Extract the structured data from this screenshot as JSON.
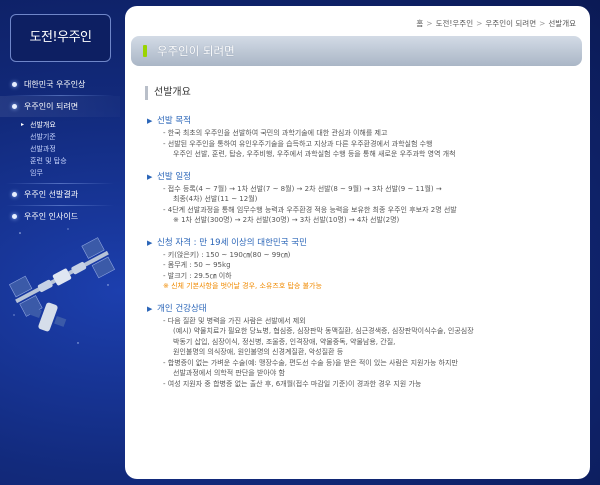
{
  "brand": {
    "logo_text": "도전!우주인"
  },
  "nav": {
    "items": [
      {
        "label": "대한민국 우주인상",
        "active": false
      },
      {
        "label": "우주인이 되려면",
        "active": true,
        "children": [
          {
            "label": "선발개요",
            "current": true
          },
          {
            "label": "선발기준",
            "current": false
          },
          {
            "label": "선발과정",
            "current": false
          },
          {
            "label": "훈련 및 탑승",
            "current": false
          },
          {
            "label": "임무",
            "current": false
          }
        ]
      },
      {
        "label": "우주인 선발결과",
        "active": false
      },
      {
        "label": "우주인 인사이드",
        "active": false
      }
    ]
  },
  "breadcrumb": [
    "홈",
    "도전!우주인",
    "우주인이 되려면",
    "선발개요"
  ],
  "breadcrumb_separator": ">",
  "page_title": "우주인이 되려면",
  "section_title": "선발개요",
  "blocks": [
    {
      "title": "선발 목적",
      "lines": [
        {
          "text": "- 한국 최초의 우주인을 선발하여 국민의 과학기술에 대한 관심과 이해를 제고",
          "indent": false,
          "warn": false
        },
        {
          "text": "- 선발된 우주인을 통하여 유인우주기술을 습득하고 지상과 다른 우주환경에서 과학실험 수행",
          "indent": false,
          "warn": false
        },
        {
          "text": "우주인 선발, 훈련, 탑승, 우주비행, 우주에서 과학실험 수행 등을 통해 새로운 우주과학 영역 개척",
          "indent": false,
          "warn": false
        }
      ]
    },
    {
      "title": "선발 일정",
      "lines": [
        {
          "text": "- 접수 등록(4 ~ 7월) → 1차 선발(7 ~ 8월) → 2차 선발(8 ~ 9월) → 3차 선발(9 ~ 11월) →",
          "indent": false,
          "warn": false
        },
        {
          "text": "최종(4차) 선발(11 ~ 12월)",
          "indent": true,
          "warn": false
        },
        {
          "text": "- 4단계 선발과정을 통해 임무수행 능력과 우주환경 적응 능력을 보유한 최종 우주인 후보자 2명 선발",
          "indent": false,
          "warn": false
        },
        {
          "text": "※ 1차 선발(300명) → 2차 선발(30명) → 3차 선발(10명) → 4차 선발(2명)",
          "indent": true,
          "warn": false
        }
      ]
    },
    {
      "title": "신청 자격 : 만 19세 이상의 대한민국 국민",
      "lines": [
        {
          "text": "- 키(앉은키) : 150 ~ 190㎝(80 ~ 99㎝)",
          "indent": false,
          "warn": false
        },
        {
          "text": "- 몸무게 : 50 ~ 95kg",
          "indent": false,
          "warn": false
        },
        {
          "text": "- 발크기 : 29.5㎝ 이하",
          "indent": false,
          "warn": false
        },
        {
          "text": "※ 신체 기본사항을 벗어날 경우, 소유즈호 탑승 불가능",
          "indent": false,
          "warn": true
        }
      ]
    },
    {
      "title": "개인 건강상태",
      "lines": [
        {
          "text": "- 다음 질환 및 병력을 가진 사람은 선발에서 제외",
          "indent": false,
          "warn": false
        },
        {
          "text": "(예시) 약물치료가 필요한 당뇨병, 협심증, 심장판막 동맥질환, 심근경색증, 심장판막이식수술, 인공심장",
          "indent": false,
          "warn": false
        },
        {
          "text": "박동기 삽입, 심장이식, 정신병, 조울증, 인격장애, 약물중독, 약물남용, 간질,",
          "indent": false,
          "warn": false
        },
        {
          "text": "원인불명의 의식장애, 원인불명의 신경계질환, 악성질환 등",
          "indent": false,
          "warn": false
        },
        {
          "text": "- 합병증이 없는 가벼운 수술(예: 맹장수술, 편도선 수술 등)을 받은 적이 있는 사람은 지원가능 하지만",
          "indent": false,
          "warn": false
        },
        {
          "text": "선발과정에서 의학적 판단을 받아야 함",
          "indent": false,
          "warn": false
        },
        {
          "text": "- 여성 지원자 중 합병증 없는 출산 후, 6개월(접수 마감일 기준)이 경과한 경우 지원 가능",
          "indent": false,
          "warn": false
        }
      ]
    }
  ],
  "colors": {
    "accent_blue": "#2a65b8",
    "warning_orange": "#f08a00",
    "title_mark_green": "#9ad400",
    "sidebar_bg": "#122a7c"
  },
  "icons": {
    "nav_bullet": "dot-icon",
    "sub_arrow": "arrow-right-icon",
    "block_bullet": "triangle-right-icon"
  }
}
